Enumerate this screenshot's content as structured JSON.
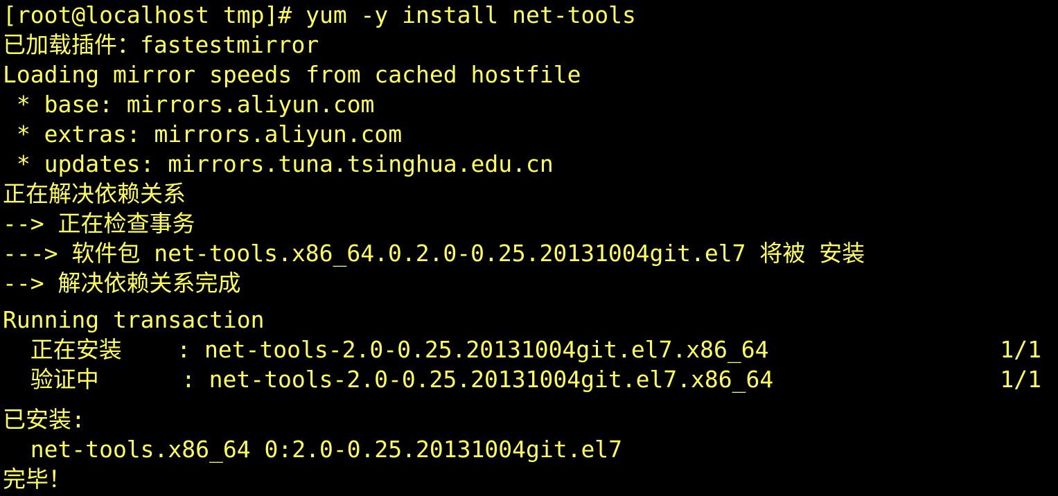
{
  "window": {
    "background_color": "#000000",
    "text_color": "#FFFF55"
  },
  "terminal": {
    "lines": [
      "[root@localhost tmp]# yum -y install net-tools",
      "已加载插件：fastestmirror",
      "Loading mirror speeds from cached hostfile",
      " * base: mirrors.aliyun.com",
      " * extras: mirrors.aliyun.com",
      " * updates: mirrors.tuna.tsinghua.edu.cn",
      "正在解决依赖关系",
      "--> 正在检查事务",
      "---> 软件包 net-tools.x86_64.0.2.0-0.25.20131004git.el7 将被 安装",
      "--> 解决依赖关系完成",
      "Running transaction",
      "  正在安装    : net-tools-2.0-0.25.20131004git.el7.x86_64",
      "  验证中      : net-tools-2.0-0.25.20131004git.el7.x86_64",
      "已安装:",
      "  net-tools.x86_64 0:2.0-0.25.20131004git.el7",
      "完毕！"
    ],
    "progress": {
      "installing": "1/1",
      "verifying": "1/1"
    }
  }
}
